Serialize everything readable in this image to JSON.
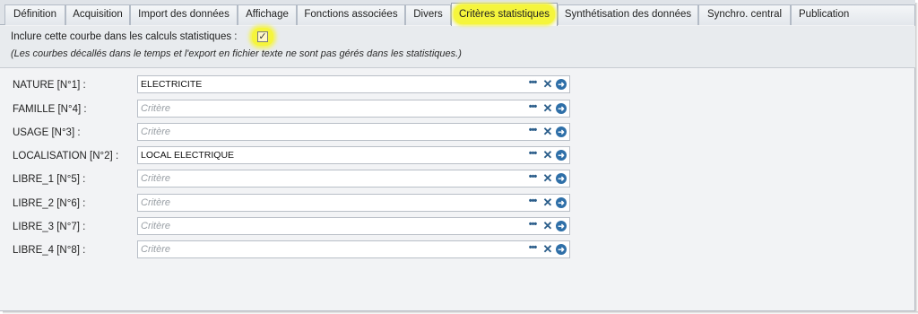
{
  "tabs": [
    {
      "label": "Définition"
    },
    {
      "label": "Acquisition"
    },
    {
      "label": "Import des données"
    },
    {
      "label": "Affichage"
    },
    {
      "label": "Fonctions associées"
    },
    {
      "label": "Divers"
    },
    {
      "label": "Critères statistiques",
      "active": true
    },
    {
      "label": "Synthétisation des données"
    },
    {
      "label": "Synchro. central"
    },
    {
      "label": "Publication"
    }
  ],
  "include": {
    "label": "Inclure cette courbe dans les calculs statistiques :",
    "checked": true,
    "check_glyph": "✓",
    "note": "(Les courbes décallés dans le temps et l'export en fichier texte ne sont pas gérés dans les statistiques.)"
  },
  "criteria": [
    {
      "label": "NATURE [N°1] :",
      "value": "ELECTRICITE",
      "placeholder": "Critère"
    },
    {
      "label": "FAMILLE [N°4] :",
      "value": "",
      "placeholder": "Critère"
    },
    {
      "label": "USAGE [N°3] :",
      "value": "",
      "placeholder": "Critère"
    },
    {
      "label": "LOCALISATION [N°2] :",
      "value": "LOCAL ELECTRIQUE",
      "placeholder": "Critère"
    },
    {
      "label": "LIBRE_1 [N°5] :",
      "value": "",
      "placeholder": "Critère"
    },
    {
      "label": "LIBRE_2 [N°6] :",
      "value": "",
      "placeholder": "Critère"
    },
    {
      "label": "LIBRE_3 [N°7] :",
      "value": "",
      "placeholder": "Critère"
    },
    {
      "label": "LIBRE_4 [N°8] :",
      "value": "",
      "placeholder": "Critère"
    }
  ],
  "icons": {
    "more": "ellipsis-icon",
    "clear": "clear-icon",
    "go": "go-arrow-icon"
  },
  "colors": {
    "highlight": "#f5f53c",
    "icon_blue": "#2e6fa8"
  }
}
